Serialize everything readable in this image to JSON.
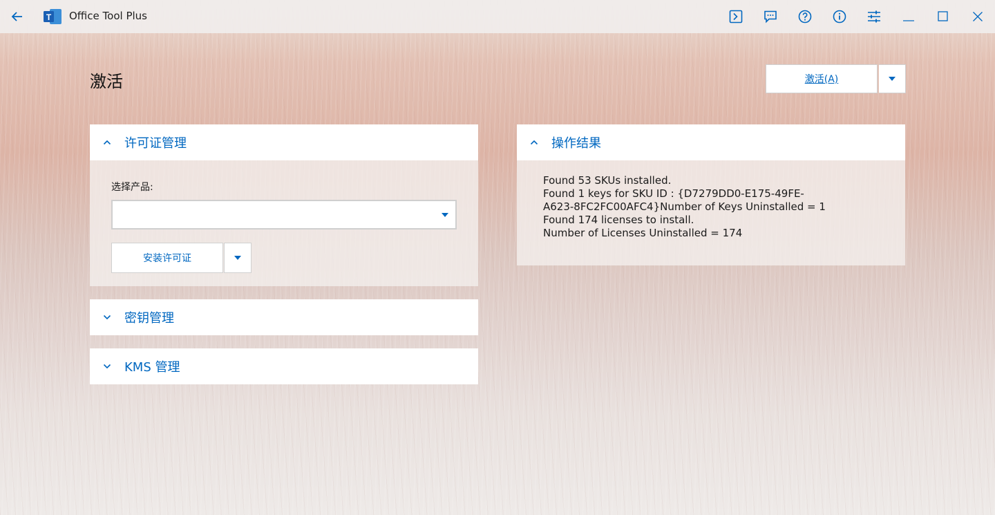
{
  "app": {
    "title": "Office Tool Plus",
    "logo_letter": "T",
    "accent": "#0067c0"
  },
  "titlebar_icons": [
    "back-icon",
    "console-icon",
    "feedback-icon",
    "help-icon",
    "info-icon",
    "settings-sliders-icon",
    "minimize-icon",
    "maximize-icon",
    "close-icon"
  ],
  "page": {
    "title": "激活"
  },
  "activate_button": {
    "label": "激活(A)"
  },
  "license_panel": {
    "title": "许可证管理",
    "select_label": "选择产品:",
    "select_value": "",
    "install_label": "安装许可证"
  },
  "key_panel": {
    "title": "密钥管理"
  },
  "kms_panel": {
    "title": "KMS 管理"
  },
  "result_panel": {
    "title": "操作结果",
    "lines": [
      "Found 53 SKUs installed.",
      "Found 1 keys for SKU ID : {D7279DD0-E175-49FE-",
      "A623-8FC2FC00AFC4}Number of Keys Uninstalled = 1",
      "Found 174 licenses to install.",
      "Number of Licenses Uninstalled = 174"
    ]
  }
}
